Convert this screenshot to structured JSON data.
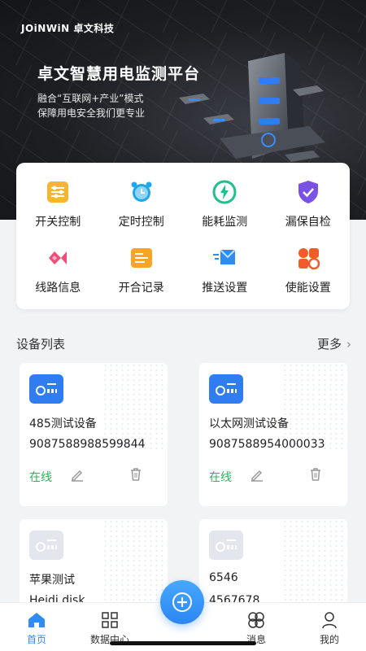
{
  "brand": "JOiNWiN 卓文科技",
  "hero": {
    "title": "卓文智慧用电监测平台",
    "subtitle1": "融合“互联网+产业”模式",
    "subtitle2": "保障用电安全我们更专业"
  },
  "quick_actions": [
    {
      "label": "开关控制",
      "icon": "switch-control-icon",
      "color": "#f5b632"
    },
    {
      "label": "定时控制",
      "icon": "alarm-clock-icon",
      "color": "#1fa8e8"
    },
    {
      "label": "能耗监测",
      "icon": "energy-monitor-icon",
      "color": "#1fc08a"
    },
    {
      "label": "漏保自检",
      "icon": "shield-check-icon",
      "color": "#7a52e6"
    },
    {
      "label": "线路信息",
      "icon": "line-info-icon",
      "color": "#f04d79"
    },
    {
      "label": "开合记录",
      "icon": "record-icon",
      "color": "#f6a623"
    },
    {
      "label": "推送设置",
      "icon": "send-icon",
      "color": "#2f8cf0"
    },
    {
      "label": "使能设置",
      "icon": "enable-settings-icon",
      "color": "#f25b2a"
    }
  ],
  "device_section": {
    "title": "设备列表",
    "more_label": "更多"
  },
  "devices": [
    {
      "name": "485测试设备",
      "serial": "9087588988599844",
      "status": "在线",
      "online": true
    },
    {
      "name": "以太网测试设备",
      "serial": "9087588954000033",
      "status": "在线",
      "online": true
    },
    {
      "name": "苹果测试",
      "serial": "Heidi disk",
      "status": "",
      "online": false
    },
    {
      "name": "6546",
      "serial": "4567678",
      "status": "",
      "online": false
    }
  ],
  "bottom_nav": [
    {
      "label": "首页",
      "icon": "home-icon",
      "active": true
    },
    {
      "label": "数据中心",
      "icon": "data-center-icon",
      "active": false
    },
    {
      "label": "消息",
      "icon": "message-icon",
      "active": false
    },
    {
      "label": "我的",
      "icon": "profile-icon",
      "active": false
    }
  ],
  "colors": {
    "accent": "#2f8cf0",
    "online": "#2bb45a",
    "device_icon": "#2f7df0"
  }
}
